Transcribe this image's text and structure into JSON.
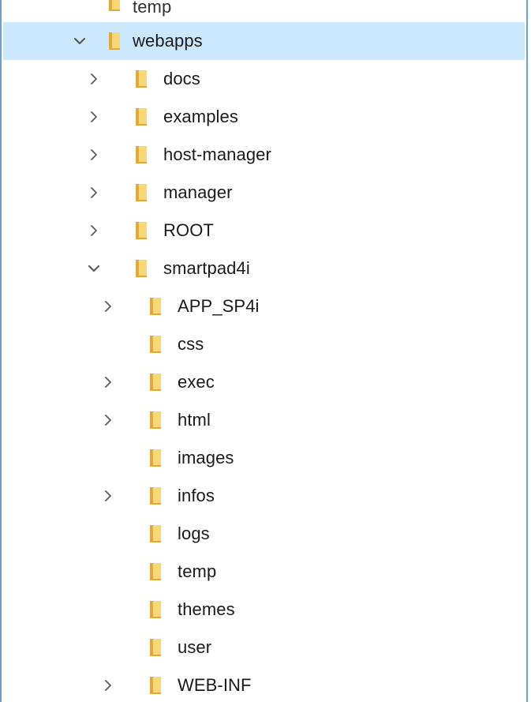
{
  "tree": {
    "items": [
      {
        "label": "temp",
        "level": 1,
        "expander": "none",
        "partial": true
      },
      {
        "label": "webapps",
        "level": 1,
        "expander": "expanded",
        "selected": true
      },
      {
        "label": "docs",
        "level": 2,
        "expander": "collapsed"
      },
      {
        "label": "examples",
        "level": 2,
        "expander": "collapsed"
      },
      {
        "label": "host-manager",
        "level": 2,
        "expander": "collapsed"
      },
      {
        "label": "manager",
        "level": 2,
        "expander": "collapsed"
      },
      {
        "label": "ROOT",
        "level": 2,
        "expander": "collapsed"
      },
      {
        "label": "smartpad4i",
        "level": 2,
        "expander": "expanded"
      },
      {
        "label": "APP_SP4i",
        "level": 3,
        "expander": "collapsed"
      },
      {
        "label": "css",
        "level": 3,
        "expander": "none"
      },
      {
        "label": "exec",
        "level": 3,
        "expander": "collapsed"
      },
      {
        "label": "html",
        "level": 3,
        "expander": "collapsed"
      },
      {
        "label": "images",
        "level": 3,
        "expander": "none"
      },
      {
        "label": "infos",
        "level": 3,
        "expander": "collapsed"
      },
      {
        "label": "logs",
        "level": 3,
        "expander": "none"
      },
      {
        "label": "temp",
        "level": 3,
        "expander": "none"
      },
      {
        "label": "themes",
        "level": 3,
        "expander": "none"
      },
      {
        "label": "user",
        "level": 3,
        "expander": "none"
      },
      {
        "label": "WEB-INF",
        "level": 3,
        "expander": "collapsed"
      }
    ],
    "icons": {
      "folder": "folder-icon",
      "expanded": "chevron-down-icon",
      "collapsed": "chevron-right-icon"
    }
  },
  "colors": {
    "selection": "#cce8ff",
    "frame_border": "#6d9fd6",
    "folder_light": "#f8d775",
    "folder_dark": "#e0a93b",
    "chevron": "#5a5a5a"
  }
}
